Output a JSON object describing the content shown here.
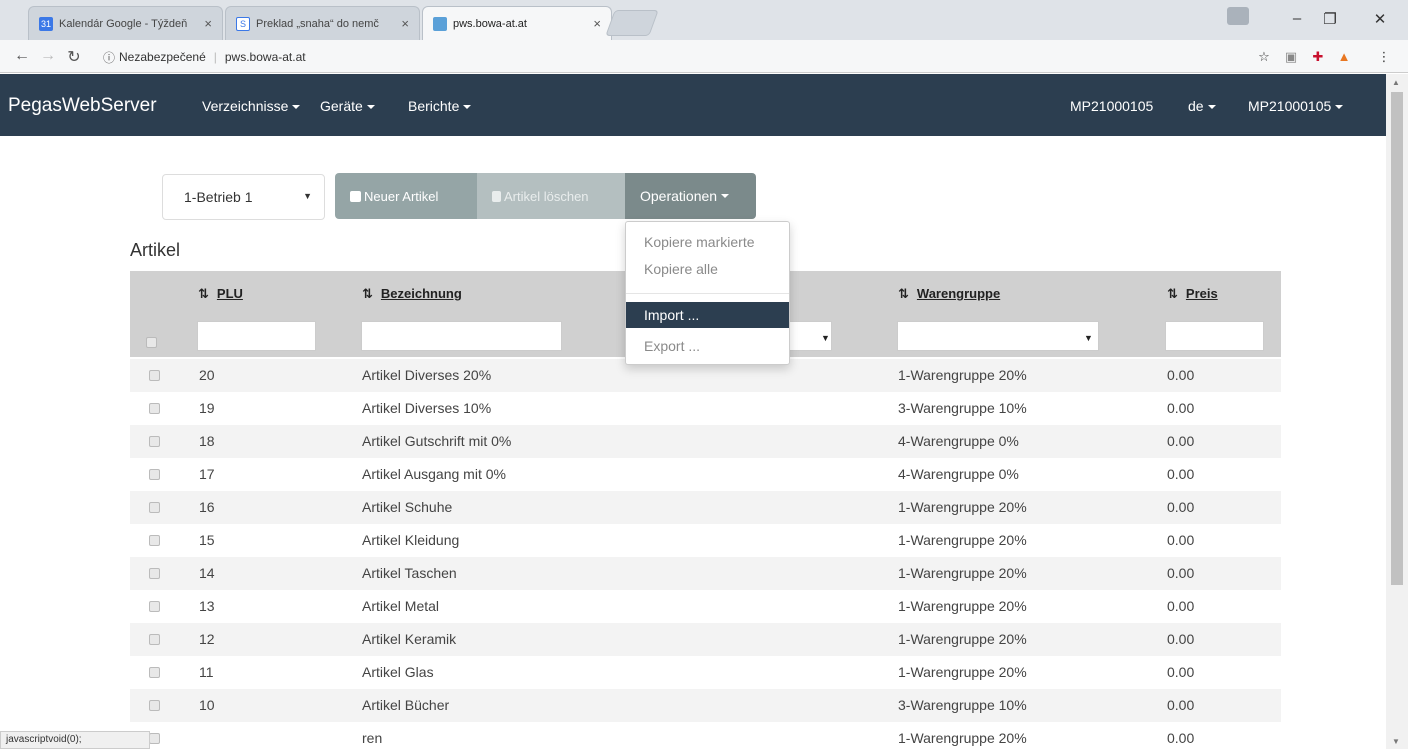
{
  "browser": {
    "tabs": [
      {
        "title": "Kalendár Google - Týždeň",
        "favicon": "31"
      },
      {
        "title": "Preklad „snaha“ do nemč",
        "favicon": "S"
      },
      {
        "title": "pws.bowa-at.at",
        "favicon": ""
      }
    ],
    "security_label": "Nezabezpečené",
    "url": "pws.bowa-at.at",
    "status_text": "javascriptvoid(0);"
  },
  "navbar": {
    "brand": "PegasWebServer",
    "menus": [
      "Verzeichnisse",
      "Geräte",
      "Berichte"
    ],
    "device_id": "MP21000105",
    "language": "de",
    "user": "MP21000105"
  },
  "toolbar": {
    "betrieb_selected": "1-Betrieb 1",
    "new_label": "Neuer Artikel",
    "delete_label": "Artikel löschen",
    "operations_label": "Operationen"
  },
  "operations_menu": {
    "copy_selected": "Kopiere markierte",
    "copy_all": "Kopiere alle",
    "import": "Import ...",
    "export": "Export ..."
  },
  "section_title": "Artikel",
  "table": {
    "columns": {
      "plu": "PLU",
      "name": "Bezeichnung",
      "group": "Warengruppe",
      "price": "Preis"
    },
    "rows": [
      {
        "plu": "20",
        "name": "Artikel Diverses 20%",
        "group": "1-Warengruppe 20%",
        "price": "0.00"
      },
      {
        "plu": "19",
        "name": "Artikel Diverses 10%",
        "group": "3-Warengruppe 10%",
        "price": "0.00"
      },
      {
        "plu": "18",
        "name": "Artikel Gutschrift mit 0%",
        "group": "4-Warengruppe 0%",
        "price": "0.00"
      },
      {
        "plu": "17",
        "name": "Artikel Ausgang mit 0%",
        "group": "4-Warengruppe 0%",
        "price": "0.00"
      },
      {
        "plu": "16",
        "name": "Artikel Schuhe",
        "group": "1-Warengruppe 20%",
        "price": "0.00"
      },
      {
        "plu": "15",
        "name": "Artikel Kleidung",
        "group": "1-Warengruppe 20%",
        "price": "0.00"
      },
      {
        "plu": "14",
        "name": "Artikel Taschen",
        "group": "1-Warengruppe 20%",
        "price": "0.00"
      },
      {
        "plu": "13",
        "name": "Artikel Metal",
        "group": "1-Warengruppe 20%",
        "price": "0.00"
      },
      {
        "plu": "12",
        "name": "Artikel Keramik",
        "group": "1-Warengruppe 20%",
        "price": "0.00"
      },
      {
        "plu": "11",
        "name": "Artikel Glas",
        "group": "1-Warengruppe 20%",
        "price": "0.00"
      },
      {
        "plu": "10",
        "name": "Artikel Bücher",
        "group": "3-Warengruppe 10%",
        "price": "0.00"
      },
      {
        "plu": "",
        "name": "ren",
        "group": "1-Warengruppe 20%",
        "price": "0.00"
      }
    ]
  },
  "colors": {
    "navbar": "#2c3e50",
    "table_header": "#d0d0d0",
    "button": "#95a5a6"
  }
}
